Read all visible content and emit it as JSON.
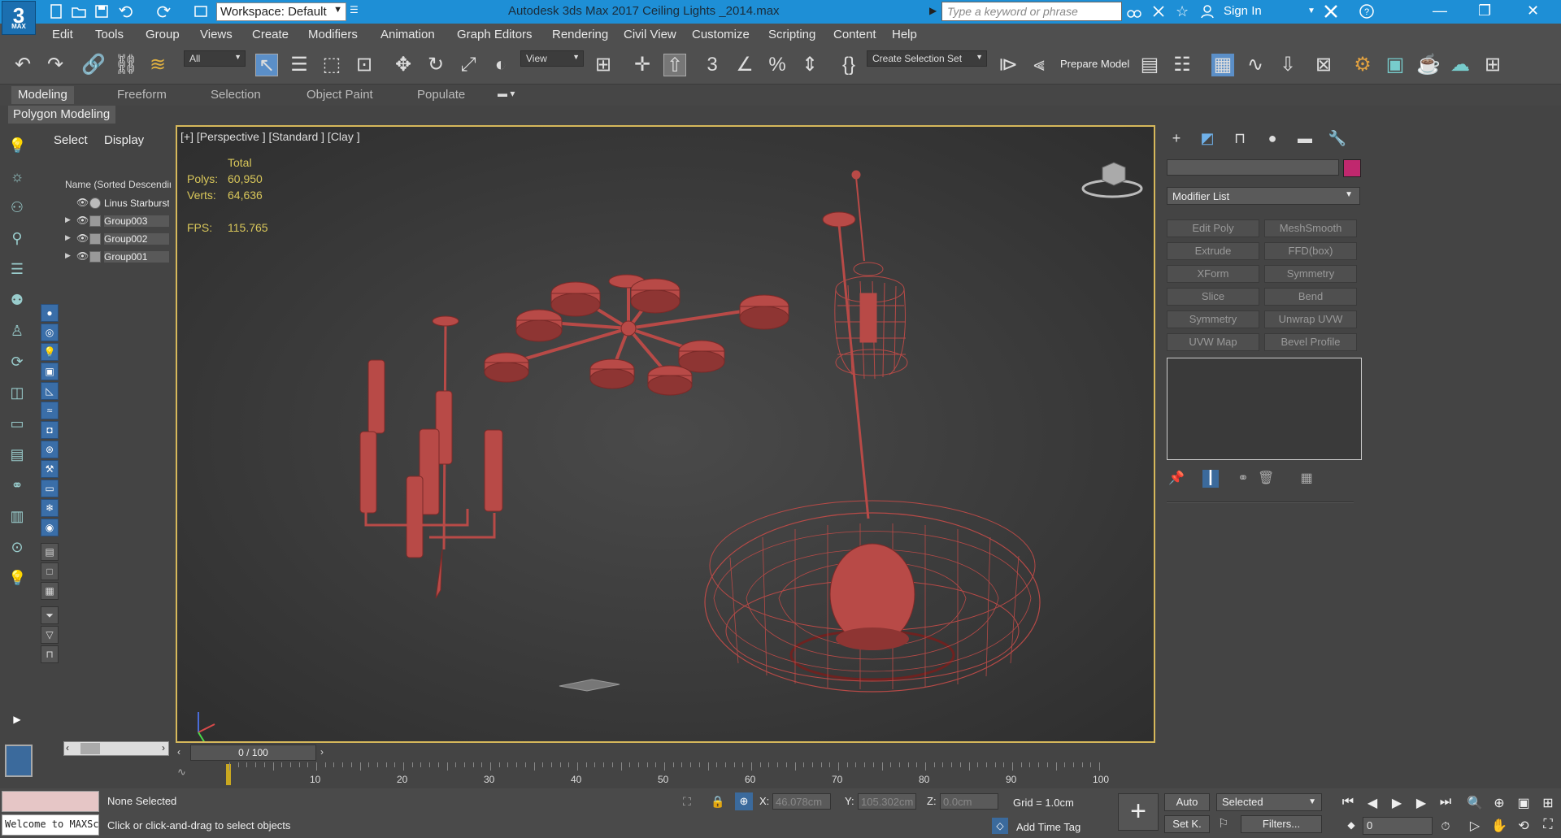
{
  "app": {
    "logo_text": "3",
    "logo_sub": "MAX",
    "workspace": "Workspace: Default",
    "title": "Autodesk 3ds Max 2017     Ceiling Lights _2014.max",
    "search_placeholder": "Type a keyword or phrase",
    "sign_in": "Sign In"
  },
  "menu": [
    "Edit",
    "Tools",
    "Group",
    "Views",
    "Create",
    "Modifiers",
    "Animation",
    "Graph Editors",
    "Rendering",
    "Civil View",
    "Customize",
    "Scripting",
    "Content",
    "Help"
  ],
  "toolbar": {
    "filter": "All",
    "refcoord": "View",
    "selection_set": "Create Selection Set",
    "prepare_model": "Prepare Model"
  },
  "ribbon": {
    "tabs": [
      "Modeling",
      "Freeform",
      "Selection",
      "Object Paint",
      "Populate"
    ],
    "active_tab": "Modeling",
    "panel": "Polygon Modeling"
  },
  "scene_explorer": {
    "tabs": [
      "Select",
      "Display"
    ],
    "column": "Name (Sorted Descending)",
    "rows": [
      {
        "name": "Linus Starburst"
      },
      {
        "name": "Group003"
      },
      {
        "name": "Group002"
      },
      {
        "name": "Group001"
      }
    ]
  },
  "viewport": {
    "label": "[+] [Perspective ] [Standard ] [Clay ]",
    "stats": {
      "total_label": "Total",
      "polys_label": "Polys:",
      "polys": "60,950",
      "verts_label": "Verts:",
      "verts": "64,636",
      "fps_label": "FPS:",
      "fps": "115.765"
    },
    "model_color": "#b84a47"
  },
  "command_panel": {
    "modifier_list": "Modifier List",
    "object_color": "#c0286e",
    "modifiers": [
      "Edit Poly",
      "MeshSmooth",
      "Extrude",
      "FFD(box)",
      "XForm",
      "Symmetry",
      "Slice",
      "Bend",
      "Symmetry",
      "Unwrap UVW",
      "UVW Map",
      "Bevel Profile"
    ]
  },
  "timeline": {
    "position": "0 / 100",
    "ticks": [
      "10",
      "20",
      "30",
      "40",
      "50",
      "60",
      "70",
      "80",
      "90",
      "100"
    ]
  },
  "status": {
    "selection": "None Selected",
    "prompt": "Click or click-and-drag to select objects",
    "maxscript": "Welcome to MAXScript.",
    "x_label": "X:",
    "x": "46.078cm",
    "y_label": "Y:",
    "y": "105.302cm",
    "z_label": "Z:",
    "z": "0.0cm",
    "grid": "Grid = 1.0cm",
    "add_time_tag": "Add Time Tag",
    "auto_key": "Auto",
    "set_key": "Set K.",
    "key_mode": "Selected",
    "filters": "Filters...",
    "frame": "0"
  }
}
